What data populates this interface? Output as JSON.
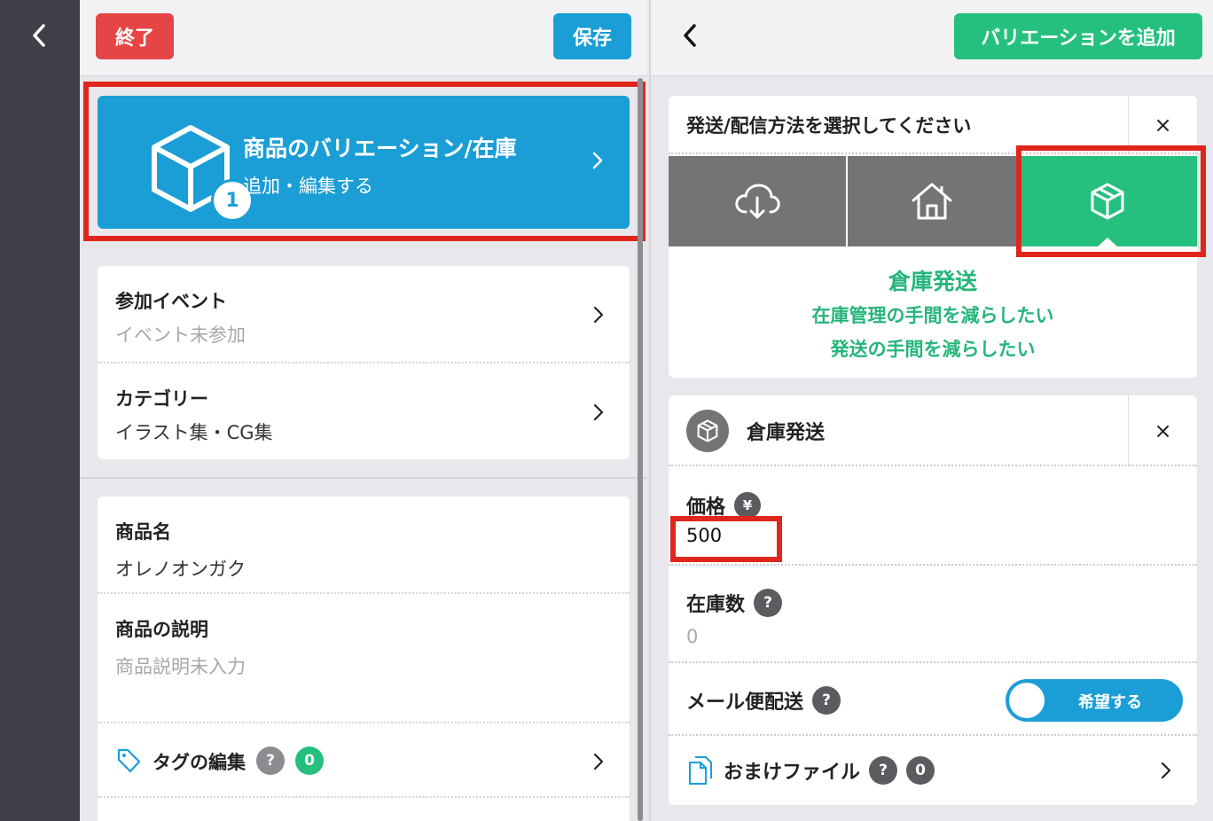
{
  "left": {
    "end_button": "終了",
    "save_button": "保存",
    "variation": {
      "title": "商品のバリエーション/在庫",
      "subtitle": "追加・編集する",
      "badge": "1"
    },
    "event": {
      "label": "参加イベント",
      "value": "イベント未参加"
    },
    "category": {
      "label": "カテゴリー",
      "value": "イラスト集・CG集"
    },
    "product_name": {
      "label": "商品名",
      "value": "オレノオンガク"
    },
    "description": {
      "label": "商品の説明",
      "value": "商品説明未入力"
    },
    "tags": {
      "label": "タグの編集",
      "help": "?",
      "count": "0"
    }
  },
  "right": {
    "add_variation_button": "バリエーションを追加",
    "shipping": {
      "title": "発送/配信方法を選択してください",
      "close": "×",
      "options": [
        {
          "name": "download",
          "icon": "cloud-download-icon",
          "selected": false
        },
        {
          "name": "home",
          "icon": "house-icon",
          "selected": false
        },
        {
          "name": "warehouse",
          "icon": "box-icon",
          "selected": true
        }
      ],
      "selected_title": "倉庫発送",
      "selected_desc1": "在庫管理の手間を減らしたい",
      "selected_desc2": "発送の手間を減らしたい"
    },
    "warehouse": {
      "title": "倉庫発送",
      "close": "×",
      "price_label": "価格",
      "price_currency": "¥",
      "price_value": "500",
      "stock_label": "在庫数",
      "stock_help": "?",
      "stock_value": "0",
      "mail_label": "メール便配送",
      "mail_help": "?",
      "mail_toggle": "希望する",
      "bonus_label": "おまけファイル",
      "bonus_help": "?",
      "bonus_count": "0"
    }
  },
  "colors": {
    "blue": "#1b9ed6",
    "green": "#26c07e",
    "red": "#e64545",
    "highlight": "#e0261c"
  }
}
